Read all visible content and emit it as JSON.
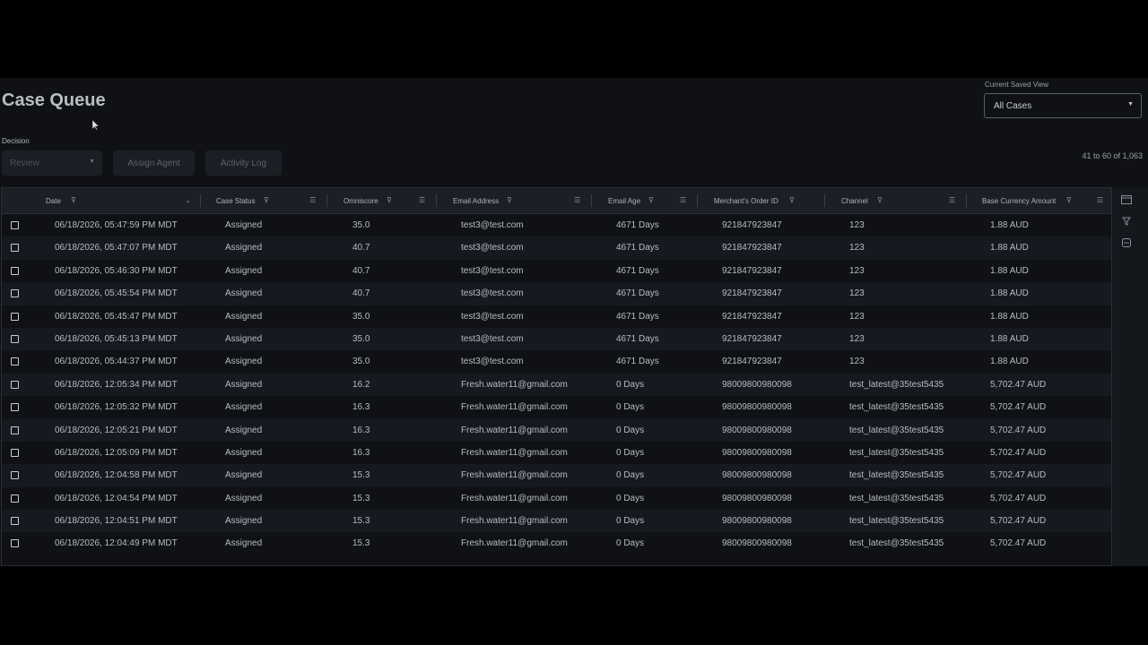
{
  "header": {
    "title": "Case Queue",
    "saved_view_label": "Current Saved View",
    "saved_view_value": "All Cases"
  },
  "toolbar": {
    "decision_label": "Decision",
    "decision_value": "Review",
    "assign_agent_label": "Assign Agent",
    "activity_log_label": "Activity Log",
    "pager_text": "41 to 60 of 1,063"
  },
  "table": {
    "columns": [
      {
        "key": "date",
        "label": "Date"
      },
      {
        "key": "status",
        "label": "Case Status"
      },
      {
        "key": "omniscore",
        "label": "Omniscore"
      },
      {
        "key": "email",
        "label": "Email Address"
      },
      {
        "key": "email_age",
        "label": "Email Age"
      },
      {
        "key": "order_id",
        "label": "Merchant's Order ID"
      },
      {
        "key": "channel",
        "label": "Channel"
      },
      {
        "key": "amount",
        "label": "Base Currency Amount"
      }
    ],
    "rows": [
      {
        "date": "06/18/2026, 05:47:59 PM MDT",
        "status": "Assigned",
        "omniscore": "35.0",
        "email": "test3@test.com",
        "email_age": "4671 Days",
        "order_id": "921847923847",
        "channel": "123",
        "amount": "1.88 AUD"
      },
      {
        "date": "06/18/2026, 05:47:07 PM MDT",
        "status": "Assigned",
        "omniscore": "40.7",
        "email": "test3@test.com",
        "email_age": "4671 Days",
        "order_id": "921847923847",
        "channel": "123",
        "amount": "1.88 AUD"
      },
      {
        "date": "06/18/2026, 05:46:30 PM MDT",
        "status": "Assigned",
        "omniscore": "40.7",
        "email": "test3@test.com",
        "email_age": "4671 Days",
        "order_id": "921847923847",
        "channel": "123",
        "amount": "1.88 AUD"
      },
      {
        "date": "06/18/2026, 05:45:54 PM MDT",
        "status": "Assigned",
        "omniscore": "40.7",
        "email": "test3@test.com",
        "email_age": "4671 Days",
        "order_id": "921847923847",
        "channel": "123",
        "amount": "1.88 AUD"
      },
      {
        "date": "06/18/2026, 05:45:47 PM MDT",
        "status": "Assigned",
        "omniscore": "35.0",
        "email": "test3@test.com",
        "email_age": "4671 Days",
        "order_id": "921847923847",
        "channel": "123",
        "amount": "1.88 AUD"
      },
      {
        "date": "06/18/2026, 05:45:13 PM MDT",
        "status": "Assigned",
        "omniscore": "35.0",
        "email": "test3@test.com",
        "email_age": "4671 Days",
        "order_id": "921847923847",
        "channel": "123",
        "amount": "1.88 AUD"
      },
      {
        "date": "06/18/2026, 05:44:37 PM MDT",
        "status": "Assigned",
        "omniscore": "35.0",
        "email": "test3@test.com",
        "email_age": "4671 Days",
        "order_id": "921847923847",
        "channel": "123",
        "amount": "1.88 AUD"
      },
      {
        "date": "06/18/2026, 12:05:34 PM MDT",
        "status": "Assigned",
        "omniscore": "16.2",
        "email": "Fresh.water11@gmail.com",
        "email_age": "0 Days",
        "order_id": "98009800980098",
        "channel": "test_latest@35test5435",
        "amount": "5,702.47 AUD"
      },
      {
        "date": "06/18/2026, 12:05:32 PM MDT",
        "status": "Assigned",
        "omniscore": "16.3",
        "email": "Fresh.water11@gmail.com",
        "email_age": "0 Days",
        "order_id": "98009800980098",
        "channel": "test_latest@35test5435",
        "amount": "5,702.47 AUD"
      },
      {
        "date": "06/18/2026, 12:05:21 PM MDT",
        "status": "Assigned",
        "omniscore": "16.3",
        "email": "Fresh.water11@gmail.com",
        "email_age": "0 Days",
        "order_id": "98009800980098",
        "channel": "test_latest@35test5435",
        "amount": "5,702.47 AUD"
      },
      {
        "date": "06/18/2026, 12:05:09 PM MDT",
        "status": "Assigned",
        "omniscore": "16.3",
        "email": "Fresh.water11@gmail.com",
        "email_age": "0 Days",
        "order_id": "98009800980098",
        "channel": "test_latest@35test5435",
        "amount": "5,702.47 AUD"
      },
      {
        "date": "06/18/2026, 12:04:58 PM MDT",
        "status": "Assigned",
        "omniscore": "15.3",
        "email": "Fresh.water11@gmail.com",
        "email_age": "0 Days",
        "order_id": "98009800980098",
        "channel": "test_latest@35test5435",
        "amount": "5,702.47 AUD"
      },
      {
        "date": "06/18/2026, 12:04:54 PM MDT",
        "status": "Assigned",
        "omniscore": "15.3",
        "email": "Fresh.water11@gmail.com",
        "email_age": "0 Days",
        "order_id": "98009800980098",
        "channel": "test_latest@35test5435",
        "amount": "5,702.47 AUD"
      },
      {
        "date": "06/18/2026, 12:04:51 PM MDT",
        "status": "Assigned",
        "omniscore": "15.3",
        "email": "Fresh.water11@gmail.com",
        "email_age": "0 Days",
        "order_id": "98009800980098",
        "channel": "test_latest@35test5435",
        "amount": "5,702.47 AUD"
      },
      {
        "date": "06/18/2026, 12:04:49 PM MDT",
        "status": "Assigned",
        "omniscore": "15.3",
        "email": "Fresh.water11@gmail.com",
        "email_age": "0 Days",
        "order_id": "98009800980098",
        "channel": "test_latest@35test5435",
        "amount": "5,702.47 AUD"
      }
    ]
  }
}
